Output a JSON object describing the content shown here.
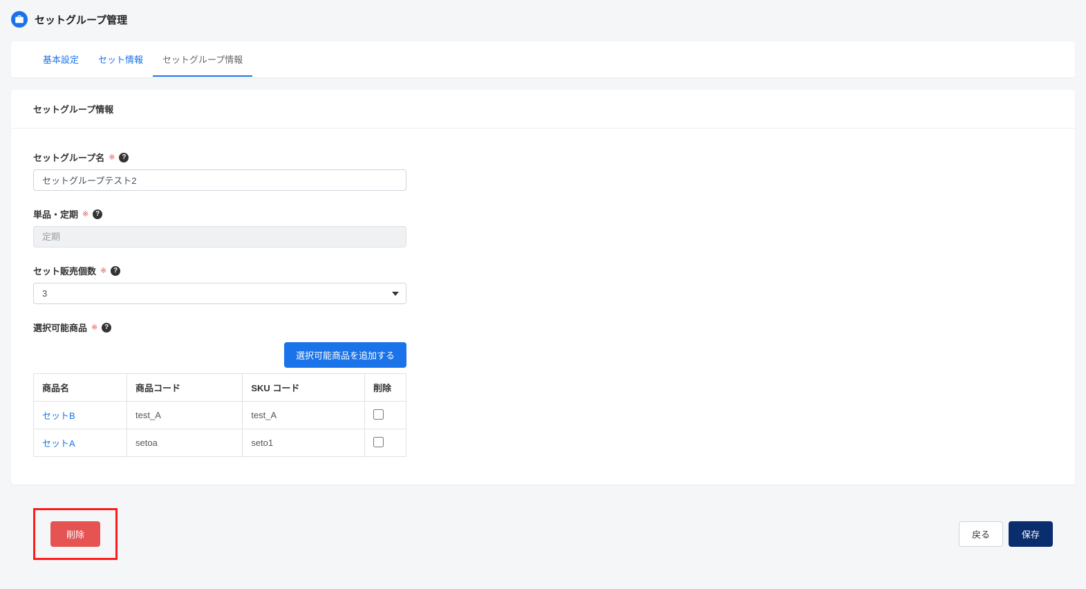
{
  "header": {
    "title": "セットグループ管理"
  },
  "tabs": [
    {
      "label": "基本設定",
      "active": false
    },
    {
      "label": "セット情報",
      "active": false
    },
    {
      "label": "セットグループ情報",
      "active": true
    }
  ],
  "section": {
    "title": "セットグループ情報"
  },
  "form": {
    "group_name": {
      "label": "セットグループ名",
      "required_mark": "※",
      "value": "セットグループテスト2"
    },
    "single_subscription": {
      "label": "単品・定期",
      "required_mark": "※",
      "value": "定期"
    },
    "sales_count": {
      "label": "セット販売個数",
      "required_mark": "※",
      "value": "3"
    },
    "selectable_products": {
      "label": "選択可能商品",
      "required_mark": "※",
      "add_button": "選択可能商品を追加する"
    }
  },
  "table": {
    "headers": {
      "product_name": "商品名",
      "product_code": "商品コード",
      "sku_code": "SKU コード",
      "delete": "削除"
    },
    "rows": [
      {
        "name": "セットB",
        "code": "test_A",
        "sku": "test_A"
      },
      {
        "name": "セットA",
        "code": "setoa",
        "sku": "seto1"
      }
    ]
  },
  "footer": {
    "delete": "削除",
    "back": "戻る",
    "save": "保存"
  }
}
